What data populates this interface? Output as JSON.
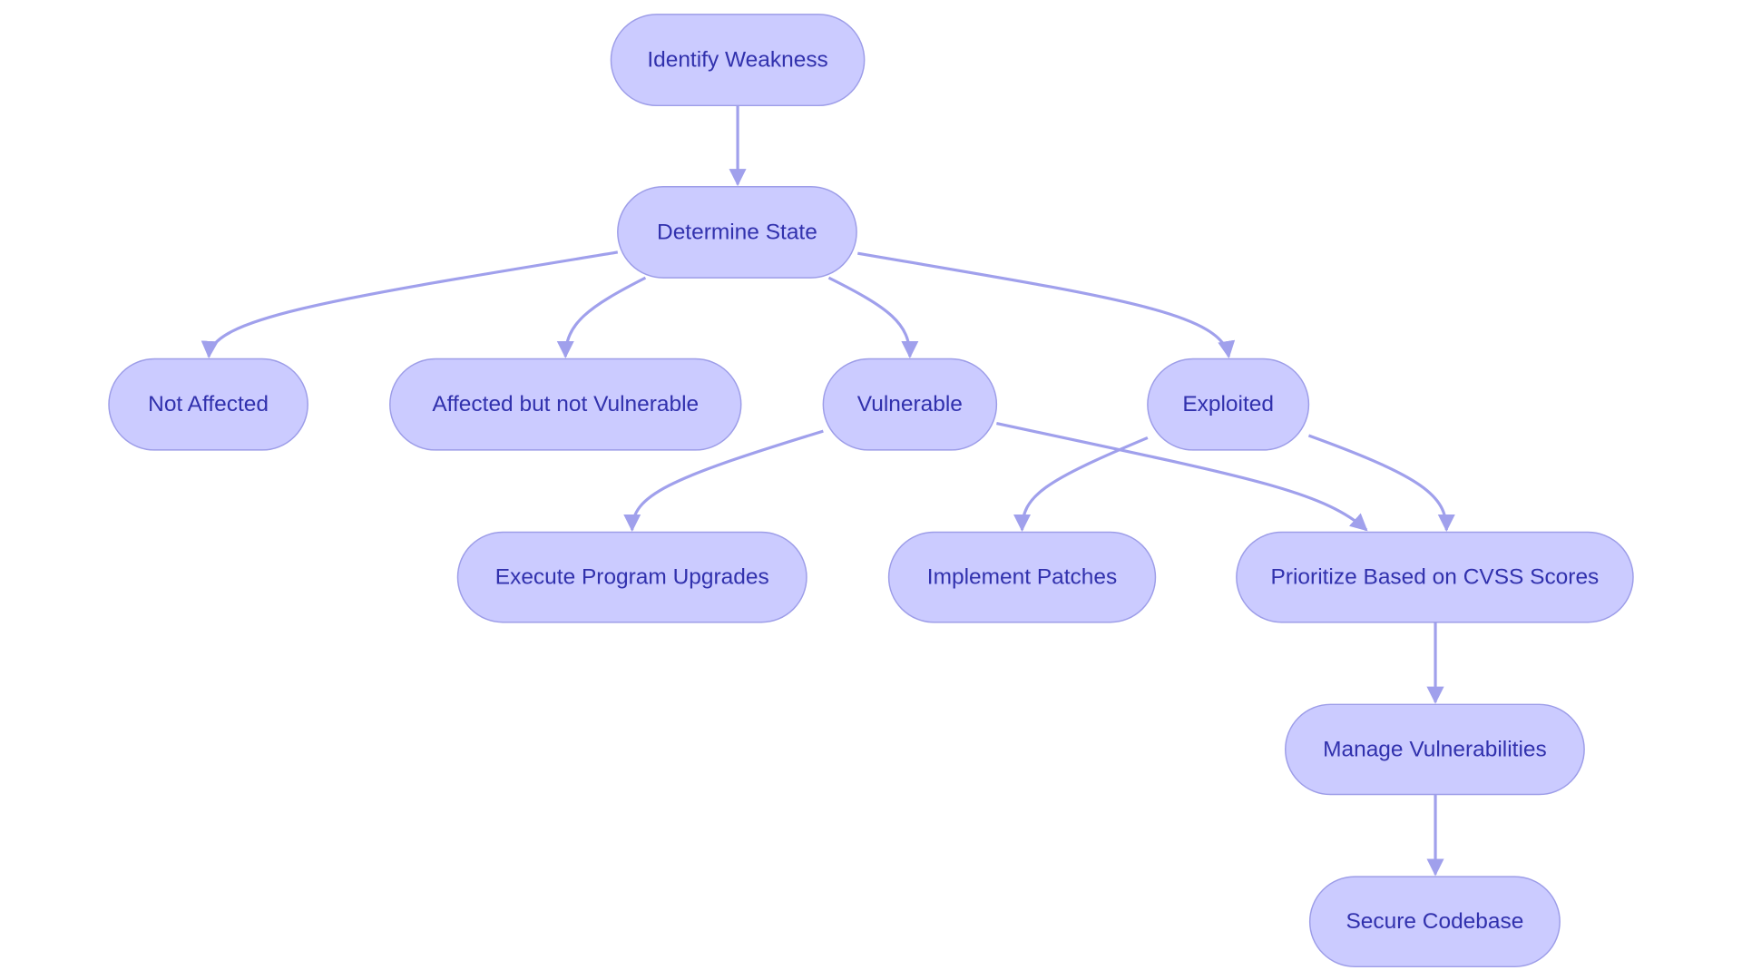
{
  "diagram": {
    "type": "flowchart",
    "colors": {
      "node_fill": "#cbcbff",
      "node_stroke": "#9d9de8",
      "text": "#3131ad",
      "edge": "#a0a0ec"
    },
    "nodes": [
      {
        "id": "identify",
        "label": "Identify Weakness"
      },
      {
        "id": "determine",
        "label": "Determine State"
      },
      {
        "id": "not_affected",
        "label": "Not Affected"
      },
      {
        "id": "affected",
        "label": "Affected but not Vulnerable"
      },
      {
        "id": "vulnerable",
        "label": "Vulnerable"
      },
      {
        "id": "exploited",
        "label": "Exploited"
      },
      {
        "id": "upgrades",
        "label": "Execute Program Upgrades"
      },
      {
        "id": "patches",
        "label": "Implement Patches"
      },
      {
        "id": "prioritize",
        "label": "Prioritize Based on CVSS Scores"
      },
      {
        "id": "manage",
        "label": "Manage Vulnerabilities"
      },
      {
        "id": "secure",
        "label": "Secure Codebase"
      }
    ],
    "edges": [
      {
        "from": "identify",
        "to": "determine"
      },
      {
        "from": "determine",
        "to": "not_affected"
      },
      {
        "from": "determine",
        "to": "affected"
      },
      {
        "from": "determine",
        "to": "vulnerable"
      },
      {
        "from": "determine",
        "to": "exploited"
      },
      {
        "from": "vulnerable",
        "to": "upgrades"
      },
      {
        "from": "vulnerable",
        "to": "prioritize"
      },
      {
        "from": "exploited",
        "to": "patches"
      },
      {
        "from": "exploited",
        "to": "prioritize"
      },
      {
        "from": "prioritize",
        "to": "manage"
      },
      {
        "from": "manage",
        "to": "secure"
      }
    ]
  }
}
